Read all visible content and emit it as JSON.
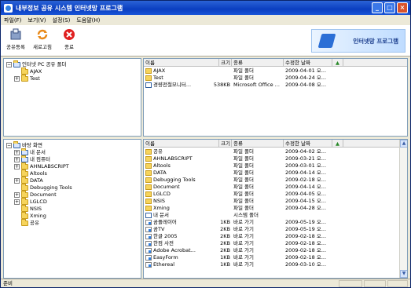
{
  "window": {
    "title": "내부정보 공유 시스템 인터넷망 프로그램"
  },
  "menu": [
    {
      "label": "파일(F)"
    },
    {
      "label": "보기(V)"
    },
    {
      "label": "설정(S)"
    },
    {
      "label": "도움말(H)"
    }
  ],
  "toolbar": {
    "buttons": [
      {
        "label": "공유등록",
        "icon": "register-icon"
      },
      {
        "label": "새로고침",
        "icon": "refresh-icon"
      },
      {
        "label": "종료",
        "icon": "exit-icon"
      }
    ],
    "banner_text": "인터넷망 프로그램"
  },
  "top_tree": {
    "items": [
      {
        "label": "인터넷 PC 공유 폴더",
        "level": 0,
        "expander": "−",
        "icon": "pc-folder"
      },
      {
        "label": "AJAX",
        "level": 1,
        "expander": "",
        "icon": "folder"
      },
      {
        "label": "Test",
        "level": 1,
        "expander": "+",
        "icon": "folder"
      }
    ]
  },
  "columns": [
    "이름",
    "크기",
    "종류",
    "수정한 날짜",
    "▲"
  ],
  "top_list": [
    {
      "name": "AJAX",
      "size": "",
      "type": "파일 폴더",
      "date": "2009-04-01 오...",
      "icon": "folder"
    },
    {
      "name": "Test",
      "size": "",
      "type": "파일 폴더",
      "date": "2009-04-24 오...",
      "icon": "folder"
    },
    {
      "name": "경량전철모니터...",
      "size": "538KB",
      "type": "Microsoft Office ...",
      "date": "2009-04-08 오...",
      "icon": "document"
    }
  ],
  "bottom_tree": {
    "items": [
      {
        "label": "바탕 화면",
        "level": 0,
        "expander": "−",
        "icon": "desktop"
      },
      {
        "label": "내 문서",
        "level": 1,
        "expander": "+",
        "icon": "document"
      },
      {
        "label": "내 컴퓨터",
        "level": 1,
        "expander": "+",
        "icon": "computer"
      },
      {
        "label": "AHNLABSCRIPT",
        "level": 1,
        "expander": "+",
        "icon": "folder"
      },
      {
        "label": "Altools",
        "level": 1,
        "expander": "",
        "icon": "folder"
      },
      {
        "label": "DATA",
        "level": 1,
        "expander": "+",
        "icon": "folder"
      },
      {
        "label": "Debugging Tools",
        "level": 1,
        "expander": "",
        "icon": "folder"
      },
      {
        "label": "Document",
        "level": 1,
        "expander": "+",
        "icon": "folder"
      },
      {
        "label": "LGLCD",
        "level": 1,
        "expander": "+",
        "icon": "folder"
      },
      {
        "label": "NSIS",
        "level": 1,
        "expander": "",
        "icon": "folder"
      },
      {
        "label": "Xming",
        "level": 1,
        "expander": "",
        "icon": "folder"
      },
      {
        "label": "공유",
        "level": 1,
        "expander": "",
        "icon": "folder"
      }
    ]
  },
  "bottom_list": [
    {
      "name": "공유",
      "size": "",
      "type": "파일 폴더",
      "date": "2009-04-02 오...",
      "icon": "folder"
    },
    {
      "name": "AHNLABSCRIPT",
      "size": "",
      "type": "파일 폴더",
      "date": "2009-03-21 오...",
      "icon": "folder"
    },
    {
      "name": "Altools",
      "size": "",
      "type": "파일 폴더",
      "date": "2009-03-01 오...",
      "icon": "folder"
    },
    {
      "name": "DATA",
      "size": "",
      "type": "파일 폴더",
      "date": "2009-04-14 오...",
      "icon": "folder"
    },
    {
      "name": "Debugging Tools",
      "size": "",
      "type": "파일 폴더",
      "date": "2009-02-18 오...",
      "icon": "folder"
    },
    {
      "name": "Document",
      "size": "",
      "type": "파일 폴더",
      "date": "2009-04-14 오...",
      "icon": "folder"
    },
    {
      "name": "LGLCD",
      "size": "",
      "type": "파일 폴더",
      "date": "2009-04-05 오...",
      "icon": "folder"
    },
    {
      "name": "NSIS",
      "size": "",
      "type": "파일 폴더",
      "date": "2009-04-15 오...",
      "icon": "folder"
    },
    {
      "name": "Xming",
      "size": "",
      "type": "파일 폴더",
      "date": "2009-04-28 오...",
      "icon": "folder"
    },
    {
      "name": "내 문서",
      "size": "",
      "type": "시스템 폴더",
      "date": "",
      "icon": "document"
    },
    {
      "name": "곰플레이어",
      "size": "1KB",
      "type": "바로 가기",
      "date": "2009-05-19 오...",
      "icon": "shortcut"
    },
    {
      "name": "곰TV",
      "size": "2KB",
      "type": "바로 가기",
      "date": "2009-05-19 오...",
      "icon": "shortcut"
    },
    {
      "name": "한글 2005",
      "size": "2KB",
      "type": "바로 가기",
      "date": "2009-02-18 오...",
      "icon": "shortcut"
    },
    {
      "name": "한컴 사전",
      "size": "2KB",
      "type": "바로 가기",
      "date": "2009-02-18 오...",
      "icon": "shortcut"
    },
    {
      "name": "Adobe Acrobat...",
      "size": "2KB",
      "type": "바로 가기",
      "date": "2009-02-18 오...",
      "icon": "shortcut"
    },
    {
      "name": "EasyForm",
      "size": "1KB",
      "type": "바로 가기",
      "date": "2009-02-18 오...",
      "icon": "shortcut"
    },
    {
      "name": "Ethereal",
      "size": "1KB",
      "type": "바로 가기",
      "date": "2009-03-10 오...",
      "icon": "shortcut"
    }
  ],
  "status": {
    "text": "준비"
  }
}
